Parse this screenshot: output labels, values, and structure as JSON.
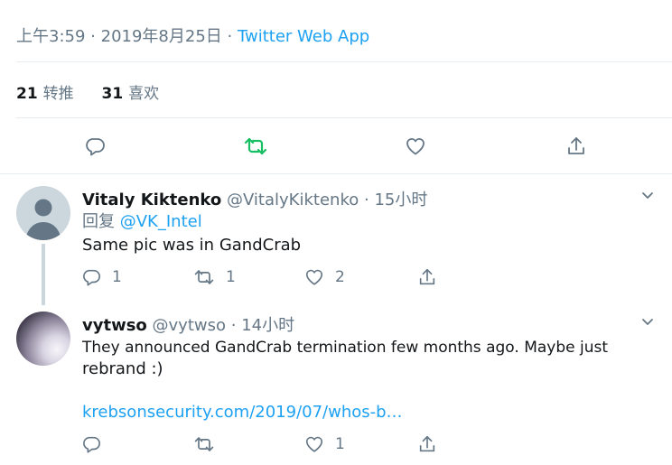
{
  "meta": {
    "time": "上午3:59",
    "separator": "·",
    "date": "2019年8月25日",
    "app": "Twitter Web App"
  },
  "stats": {
    "retweets_count": "21",
    "retweets_label": "转推",
    "likes_count": "31",
    "likes_label": "喜欢"
  },
  "colors": {
    "accent": "#1da1f2",
    "retweet_active": "#17bf63",
    "muted": "#657786"
  },
  "main_actions": {
    "reply_icon": "reply-icon",
    "retweet_icon": "retweet-icon",
    "like_icon": "heart-icon",
    "share_icon": "share-icon"
  },
  "replies": [
    {
      "name": "Vitaly Kiktenko",
      "handle": "@VitalyKiktenko",
      "separator": "·",
      "time": "15小时",
      "reply_prefix": "回复",
      "reply_to": "@VK_Intel",
      "text": "Same pic was in GandCrab",
      "reply_count": "1",
      "retweet_count": "1",
      "like_count": "2"
    },
    {
      "name": "vytwso",
      "handle": "@vytwso",
      "separator": "·",
      "time": "14小时",
      "text_line1": "They announced GandCrab termination few months ago. Maybe just",
      "text_line2": "rebrand :)",
      "link": "krebsonsecurity.com/2019/07/whos-b…",
      "reply_count": "",
      "retweet_count": "",
      "like_count": "1"
    }
  ]
}
